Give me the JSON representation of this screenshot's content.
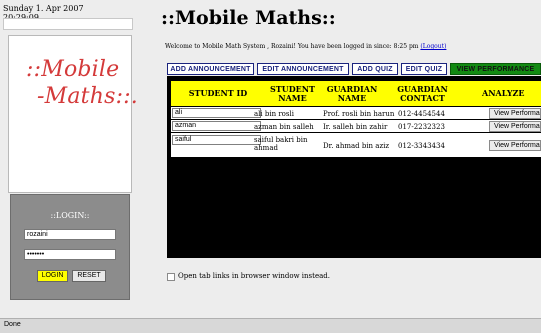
{
  "sidebar": {
    "date_line1": "Sunday 1. Apr 2007",
    "date_line2": "20:29:09",
    "logo_line1": "::Mobile",
    "logo_line2": "-Maths::.",
    "login_title": "::LOGIN::",
    "username_value": "rozaini",
    "password_value": "•••••••",
    "login_label": "LOGIN",
    "reset_label": "RESET"
  },
  "header": {
    "title": "::Mobile Maths::",
    "welcome_prefix": "Welcome to Mobile Math System , Rozaini! You have been logged in since: 8:25 pm",
    "logout_label": "(Logout)"
  },
  "tabs": [
    "ADD ANNOUNCEMENT",
    "EDIT ANNOUNCEMENT",
    "ADD QUIZ",
    "EDIT QUIZ",
    "VIEW PERFORMANCE"
  ],
  "table": {
    "headers": [
      "STUDENT ID",
      "STUDENT NAME",
      "GUARDIAN NAME",
      "GUARDIAN CONTACT",
      "ANALYZE"
    ],
    "rows": [
      {
        "id": "ali",
        "name": "ali bin rosli",
        "guardian": "Prof. rosli bin harun",
        "contact": "012-4454544",
        "action": "View Performance"
      },
      {
        "id": "azman",
        "name": "azman bin salleh",
        "guardian": "Ir. salleh bin zahir",
        "contact": "017-2232323",
        "action": "View Performance"
      },
      {
        "id": "saiful",
        "name": "saiful bakri bin ahmad",
        "guardian": "Dr. ahmad bin aziz",
        "contact": "012-3343434",
        "action": "View Performance"
      }
    ]
  },
  "option_label": "Open tab links in browser window instead.",
  "status_bar": "Done"
}
